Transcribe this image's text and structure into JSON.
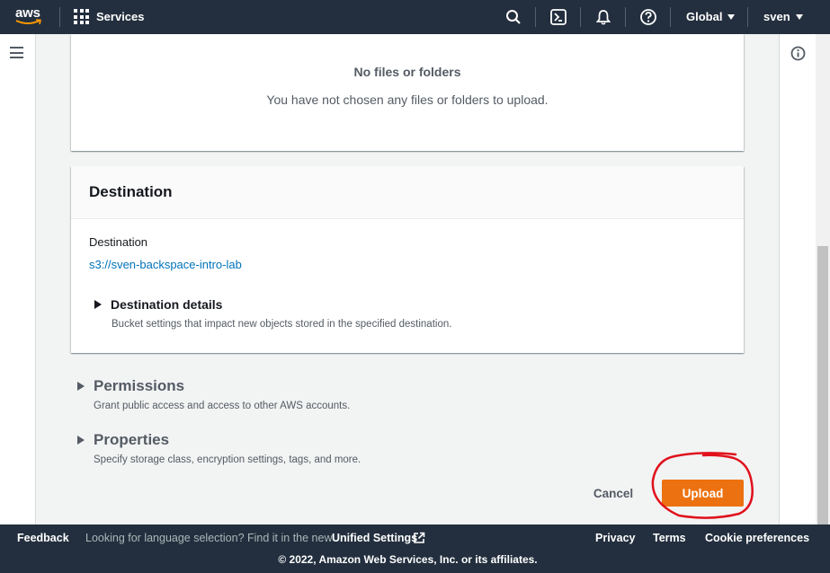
{
  "topnav": {
    "logo_text": "aws",
    "services_label": "Services",
    "region_label": "Global",
    "user_label": "sven",
    "icons": [
      "search-icon",
      "cloudshell-icon",
      "notifications-icon",
      "help-icon"
    ]
  },
  "files": {
    "empty_title": "No files or folders",
    "empty_message": "You have not chosen any files or folders to upload."
  },
  "destination": {
    "header": "Destination",
    "label": "Destination",
    "link": "s3://sven-backspace-intro-lab",
    "details_title": "Destination details",
    "details_description": "Bucket settings that impact new objects stored in the specified destination."
  },
  "permissions": {
    "title": "Permissions",
    "description": "Grant public access and access to other AWS accounts."
  },
  "properties": {
    "title": "Properties",
    "description": "Specify storage class, encryption settings, tags, and more."
  },
  "actions": {
    "cancel_label": "Cancel",
    "upload_label": "Upload"
  },
  "footer": {
    "feedback": "Feedback",
    "language_prompt": "Looking for language selection? Find it in the new",
    "unified_settings": "Unified Settings",
    "privacy": "Privacy",
    "terms": "Terms",
    "cookie_preferences": "Cookie preferences",
    "copyright": "© 2022, Amazon Web Services, Inc. or its affiliates."
  },
  "colors": {
    "nav_bg": "#232f3e",
    "primary_button": "#ec7211",
    "link": "#0073bb",
    "annotation": "#e0101c"
  }
}
